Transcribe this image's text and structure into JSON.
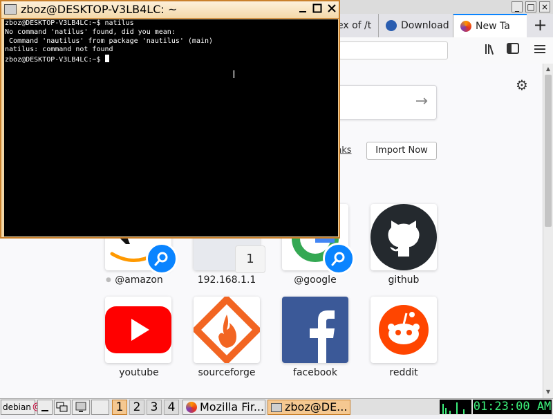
{
  "browser": {
    "tabs": [
      {
        "label": "ex of /t"
      },
      {
        "label": "Download"
      },
      {
        "label": "New Ta"
      }
    ],
    "new_tab_symbol": "+",
    "window_controls": [
      "_",
      "□",
      "×"
    ],
    "newtab": {
      "bookmarks_link": "nks",
      "import_button": "Import Now",
      "top_sites": [
        {
          "label": "@amazon",
          "search_shortcut": true,
          "brand_color": "#ff9900"
        },
        {
          "label": "192.168.1.1",
          "pin_number": "1"
        },
        {
          "label": "@google",
          "search_shortcut": true,
          "brand_color": "#4285f4"
        },
        {
          "label": "github",
          "brand_color": "#24292e"
        },
        {
          "label": "youtube",
          "brand_color": "#ff0000"
        },
        {
          "label": "sourceforge",
          "brand_color": "#f26522"
        },
        {
          "label": "facebook",
          "brand_color": "#3b5998"
        },
        {
          "label": "reddit",
          "brand_color": "#ff4500"
        }
      ]
    }
  },
  "terminal": {
    "title": "zboz@DESKTOP-V3LB4LC: ~",
    "lines": [
      "zboz@DESKTOP-V3LB4LC:~$ natilus",
      "No command 'natilus' found, did you mean:",
      " Command 'nautilus' from package 'nautilus' (main)",
      "natilus: command not found",
      "zboz@DESKTOP-V3LB4LC:~$ "
    ]
  },
  "taskbar": {
    "start_label": "debian",
    "workspaces": [
      "1",
      "2",
      "3",
      "4"
    ],
    "active_workspace": "1",
    "tasks": [
      {
        "label": "Mozilla Fir..."
      },
      {
        "label": "zboz@DE..."
      }
    ],
    "clock": "01:23:00 AM"
  },
  "colors": {
    "accent": "#0a84ff",
    "terminal_border": "#c9802b",
    "clock_text": "#3cf07a"
  }
}
